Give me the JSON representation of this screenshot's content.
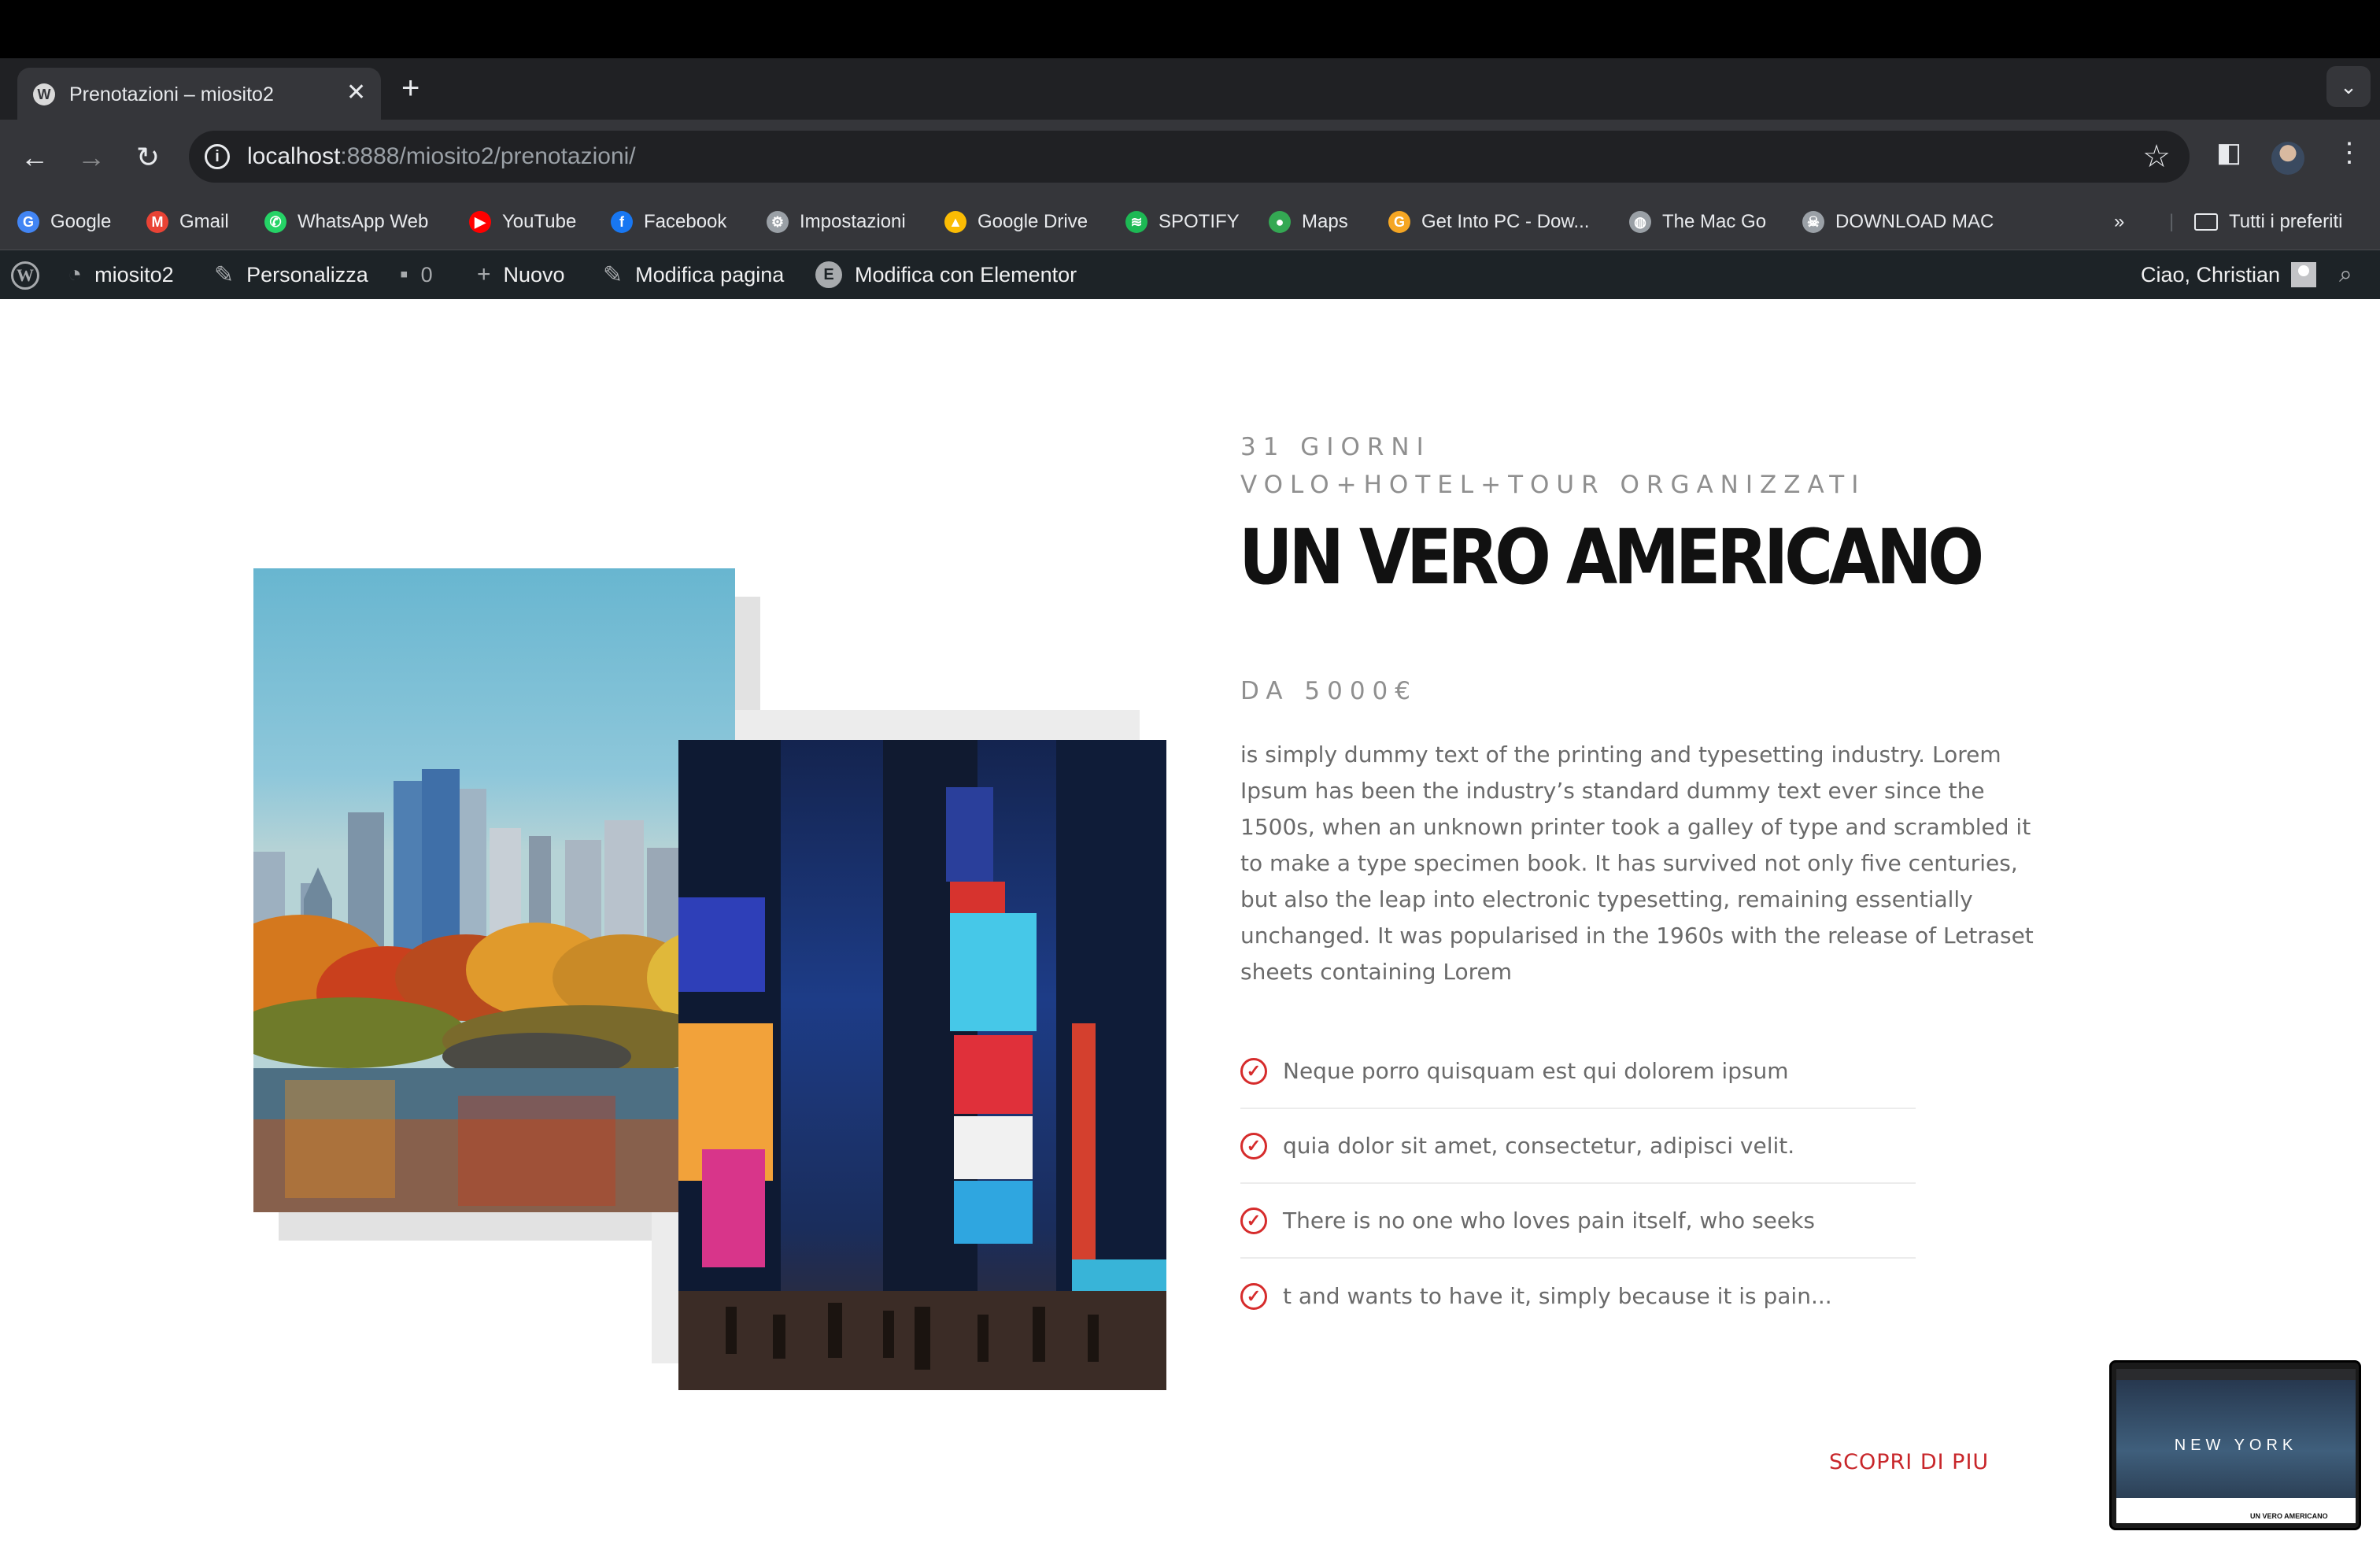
{
  "browser": {
    "tab_title": "Prenotazioni – miosito2",
    "url_host": "localhost",
    "url_rest": ":8888/miosito2/prenotazioni/",
    "bookmarks": [
      {
        "label": "Google",
        "icon": "google-icon",
        "color": "#4285f4"
      },
      {
        "label": "Gmail",
        "icon": "gmail-icon",
        "color": "#ea4335"
      },
      {
        "label": "WhatsApp Web",
        "icon": "whatsapp-icon",
        "color": "#25d366"
      },
      {
        "label": "YouTube",
        "icon": "youtube-icon",
        "color": "#ff0000"
      },
      {
        "label": "Facebook",
        "icon": "facebook-icon",
        "color": "#1877f2"
      },
      {
        "label": "Impostazioni",
        "icon": "gear-icon",
        "color": "#9aa0a6"
      },
      {
        "label": "Google Drive",
        "icon": "drive-icon",
        "color": "#fbbc04"
      },
      {
        "label": "SPOTIFY",
        "icon": "spotify-icon",
        "color": "#1db954"
      },
      {
        "label": "Maps",
        "icon": "maps-icon",
        "color": "#34a853"
      },
      {
        "label": "Get Into PC - Dow...",
        "icon": "getintopc-icon",
        "color": "#f5a623"
      },
      {
        "label": "The Mac Go",
        "icon": "globe-icon",
        "color": "#9aa0a6"
      },
      {
        "label": "DOWNLOAD MAC",
        "icon": "skull-icon",
        "color": "#9aa0a6"
      }
    ],
    "all_bookmarks_label": "Tutti i preferiti"
  },
  "wp_admin": {
    "site_name": "miosito2",
    "customize": "Personalizza",
    "comments_count": "0",
    "new": "Nuovo",
    "edit_page": "Modifica pagina",
    "edit_elementor": "Modifica con Elementor",
    "greeting": "Ciao, Christian"
  },
  "section": {
    "eyebrow_line1": "31 GIORNI",
    "eyebrow_line2": "VOLO+HOTEL+TOUR ORGANIZZATI",
    "headline": "UN VERO AMERICANO",
    "price": "DA 5000€",
    "body": "is simply dummy text of the printing and typesetting industry. Lorem Ipsum has been the industry’s standard dummy text ever since the 1500s, when an unknown printer took a galley of type and scrambled it to make a type specimen book. It has survived not only five centuries, but also the leap into electronic typesetting, remaining essentially unchanged. It was popularised in the 1960s with the release of Letraset sheets containing Lorem",
    "features": [
      "Neque porro quisquam est qui dolorem ipsum",
      "quia dolor sit amet, consectetur, adipisci velit.",
      "There is no one who loves pain itself, who seeks",
      "t and wants to have it, simply because it is pain..."
    ],
    "cta": "SCOPRI DI PIU",
    "accent_color": "#d62c2c"
  },
  "thumbnail": {
    "title": "NEW YORK",
    "subtitle": "UN VERO AMERICANO"
  }
}
